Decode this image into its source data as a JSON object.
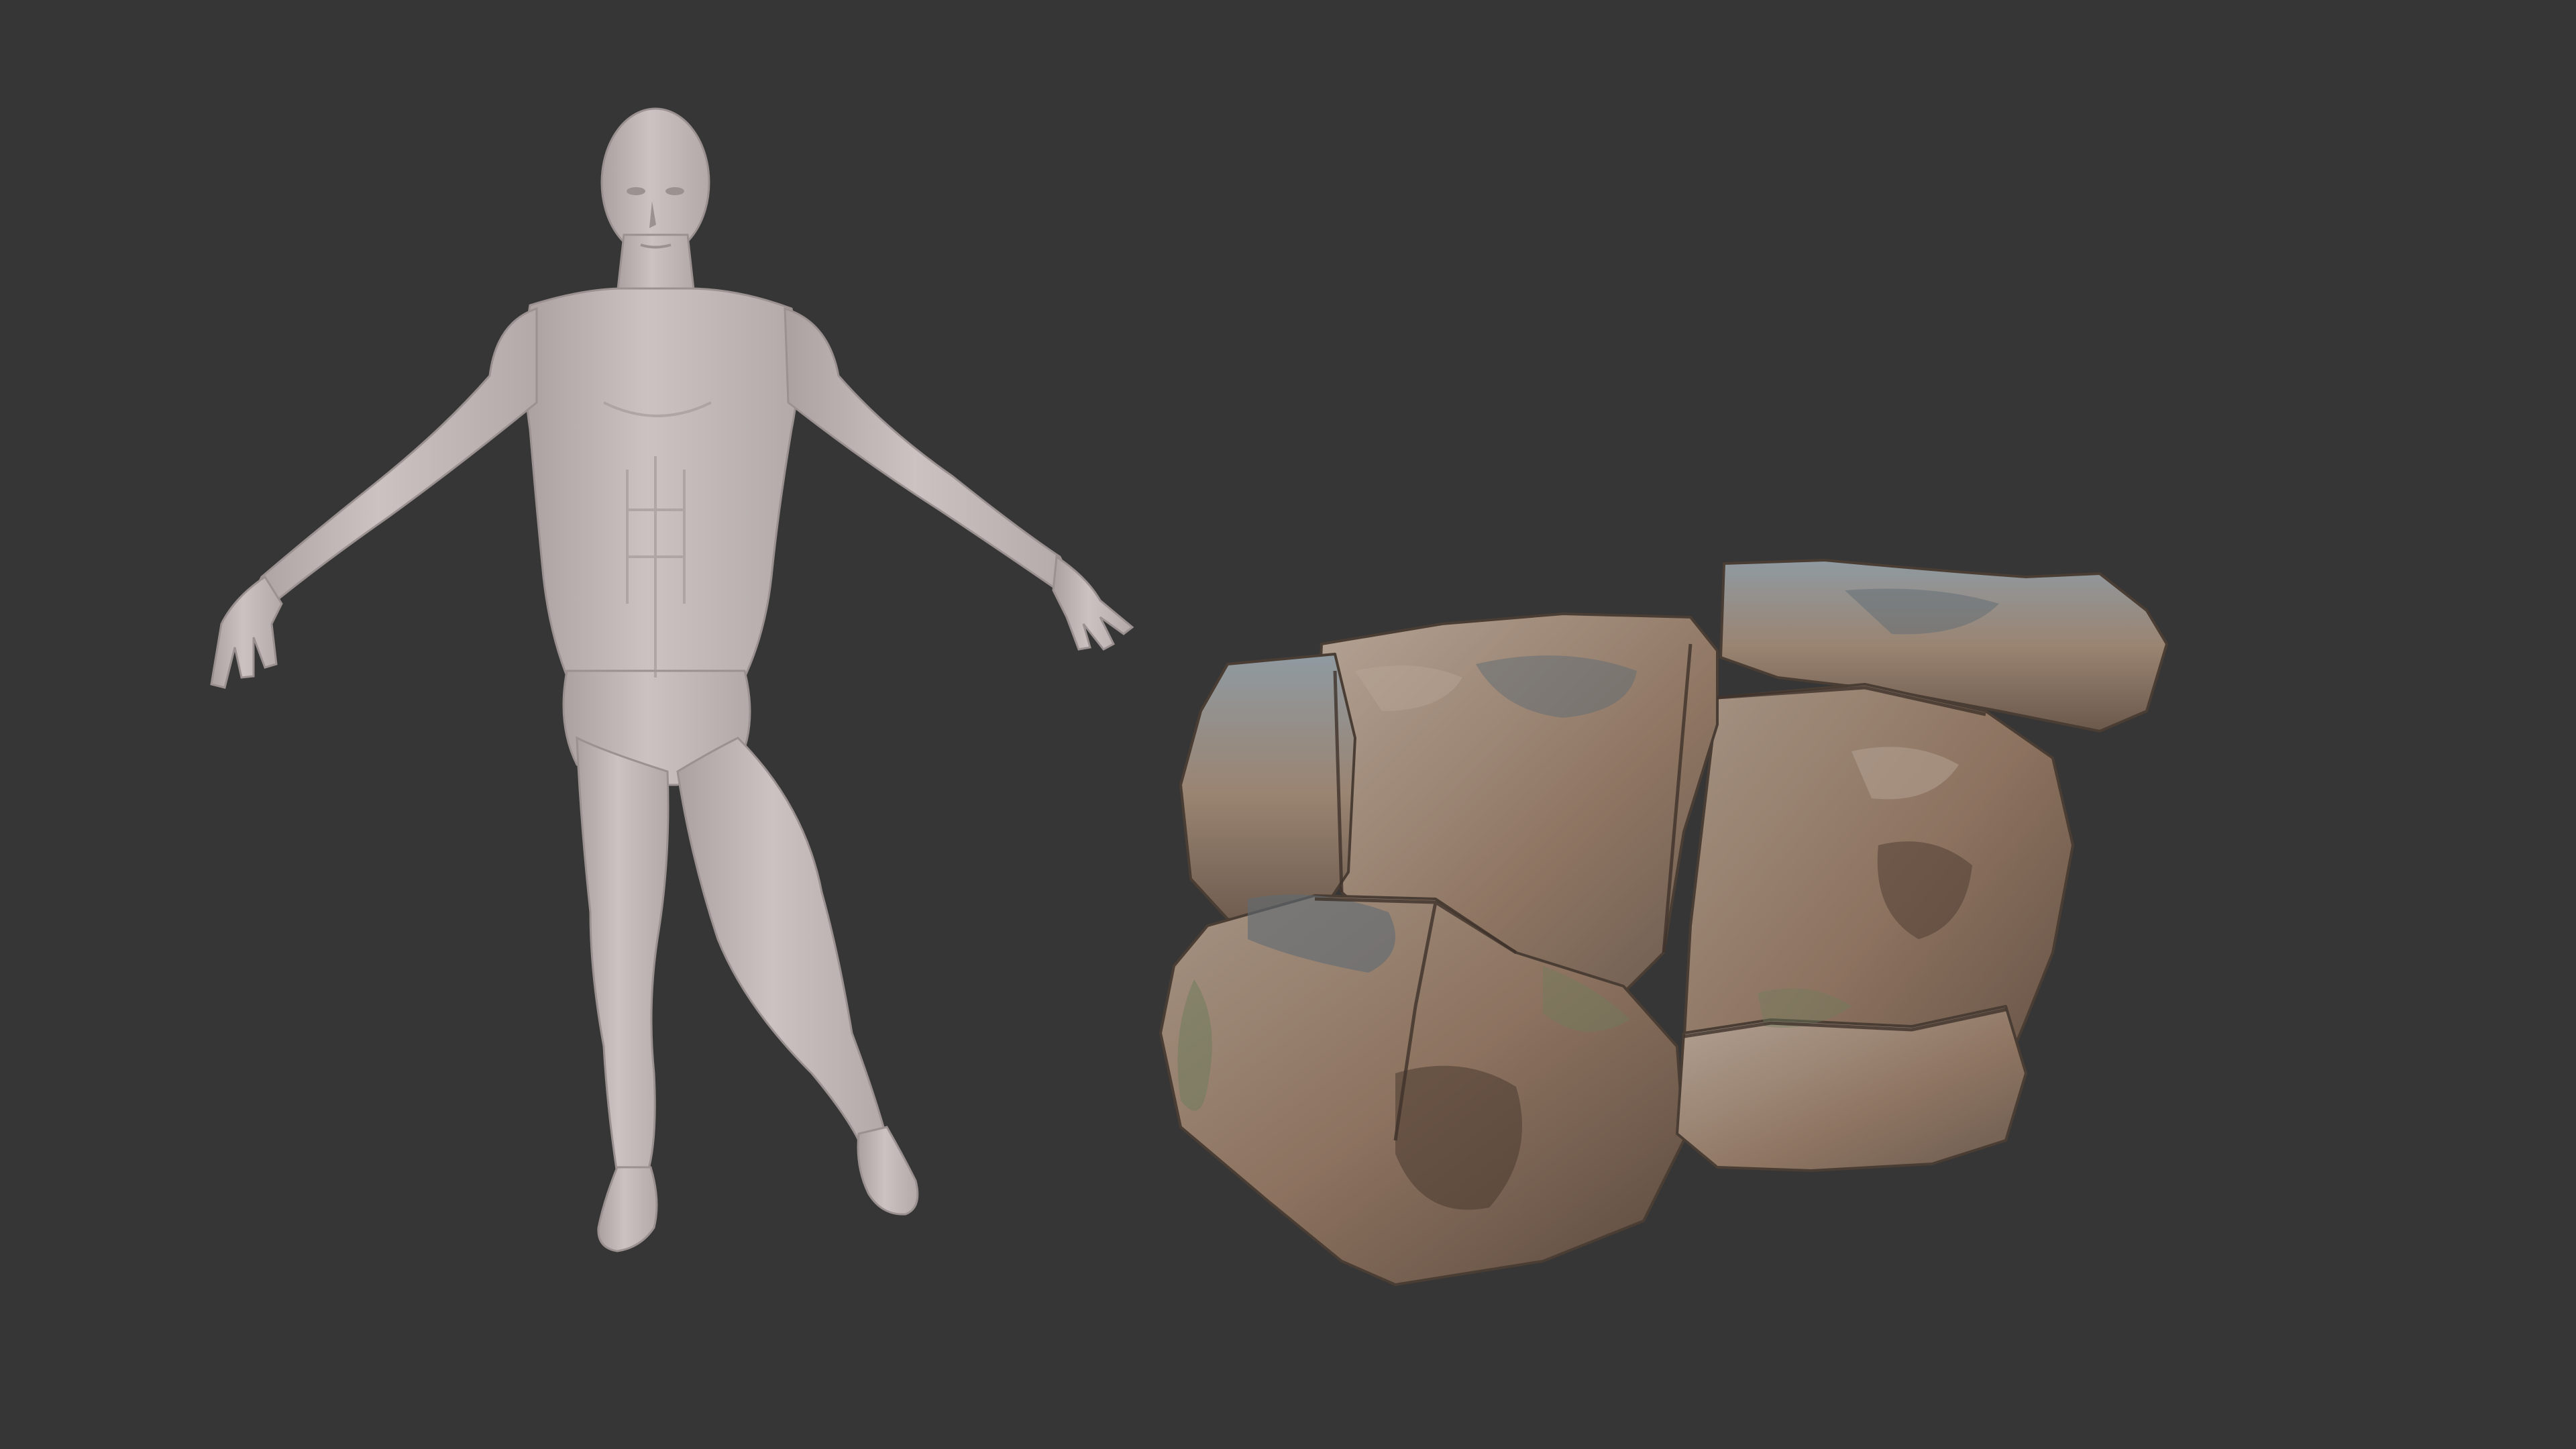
{
  "viewport": {
    "background_color": "#363636"
  },
  "objects": [
    {
      "kind": "human-figure-model",
      "icon": "human-figure",
      "base_color": "#c7bebd",
      "shadow_color": "#a09796"
    },
    {
      "kind": "rock-model",
      "icon": "rock",
      "base_color": "#8a7361",
      "highlight_color": "#b7a697",
      "moss_color": "#6f7c5c",
      "slate_color": "#5f6b73"
    }
  ]
}
